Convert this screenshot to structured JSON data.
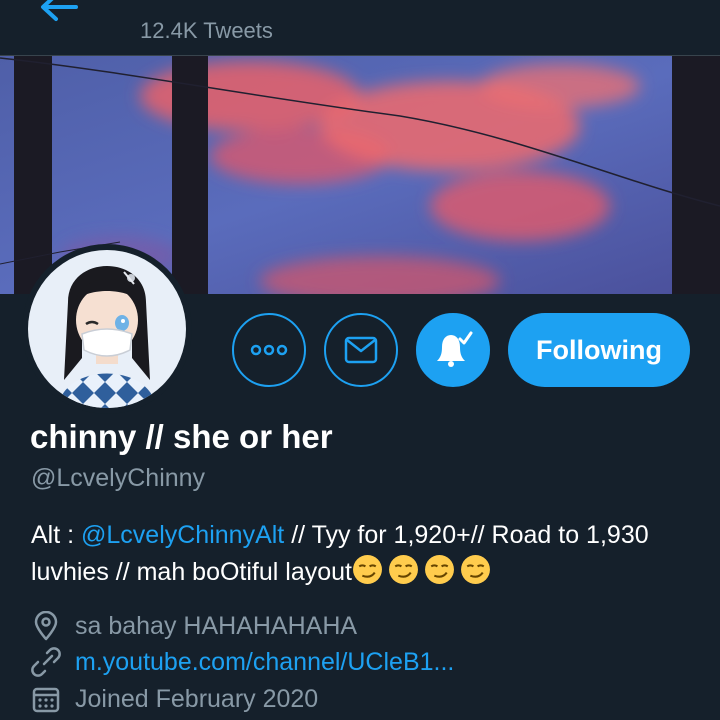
{
  "header": {
    "tweet_count": "12.4K Tweets"
  },
  "actions": {
    "follow_label": "Following"
  },
  "profile": {
    "name": "chinny // she or her",
    "handle": "@LcvelyChinny",
    "bio_prefix": "Alt : ",
    "bio_mention": "@LcvelyChinnyAlt",
    "bio_rest": " // Tyy for 1,920+// Road to 1,930 luvhies // mah boOtiful layout",
    "location": "sa bahay HAHAHAHAHA",
    "website": "m.youtube.com/channel/UCleB1...",
    "joined": "Joined February 2020"
  },
  "icons": {
    "back": "arrow-left-icon",
    "more": "more-icon",
    "message": "envelope-icon",
    "notifications": "bell-check-icon",
    "location": "location-pin-icon",
    "website": "link-icon",
    "joined": "calendar-icon",
    "bio_emoji": "smirking-face-emoji"
  },
  "colors": {
    "background": "#15202b",
    "accent": "#1da1f2",
    "secondary_text": "#8899a6",
    "divider": "#38444d"
  }
}
